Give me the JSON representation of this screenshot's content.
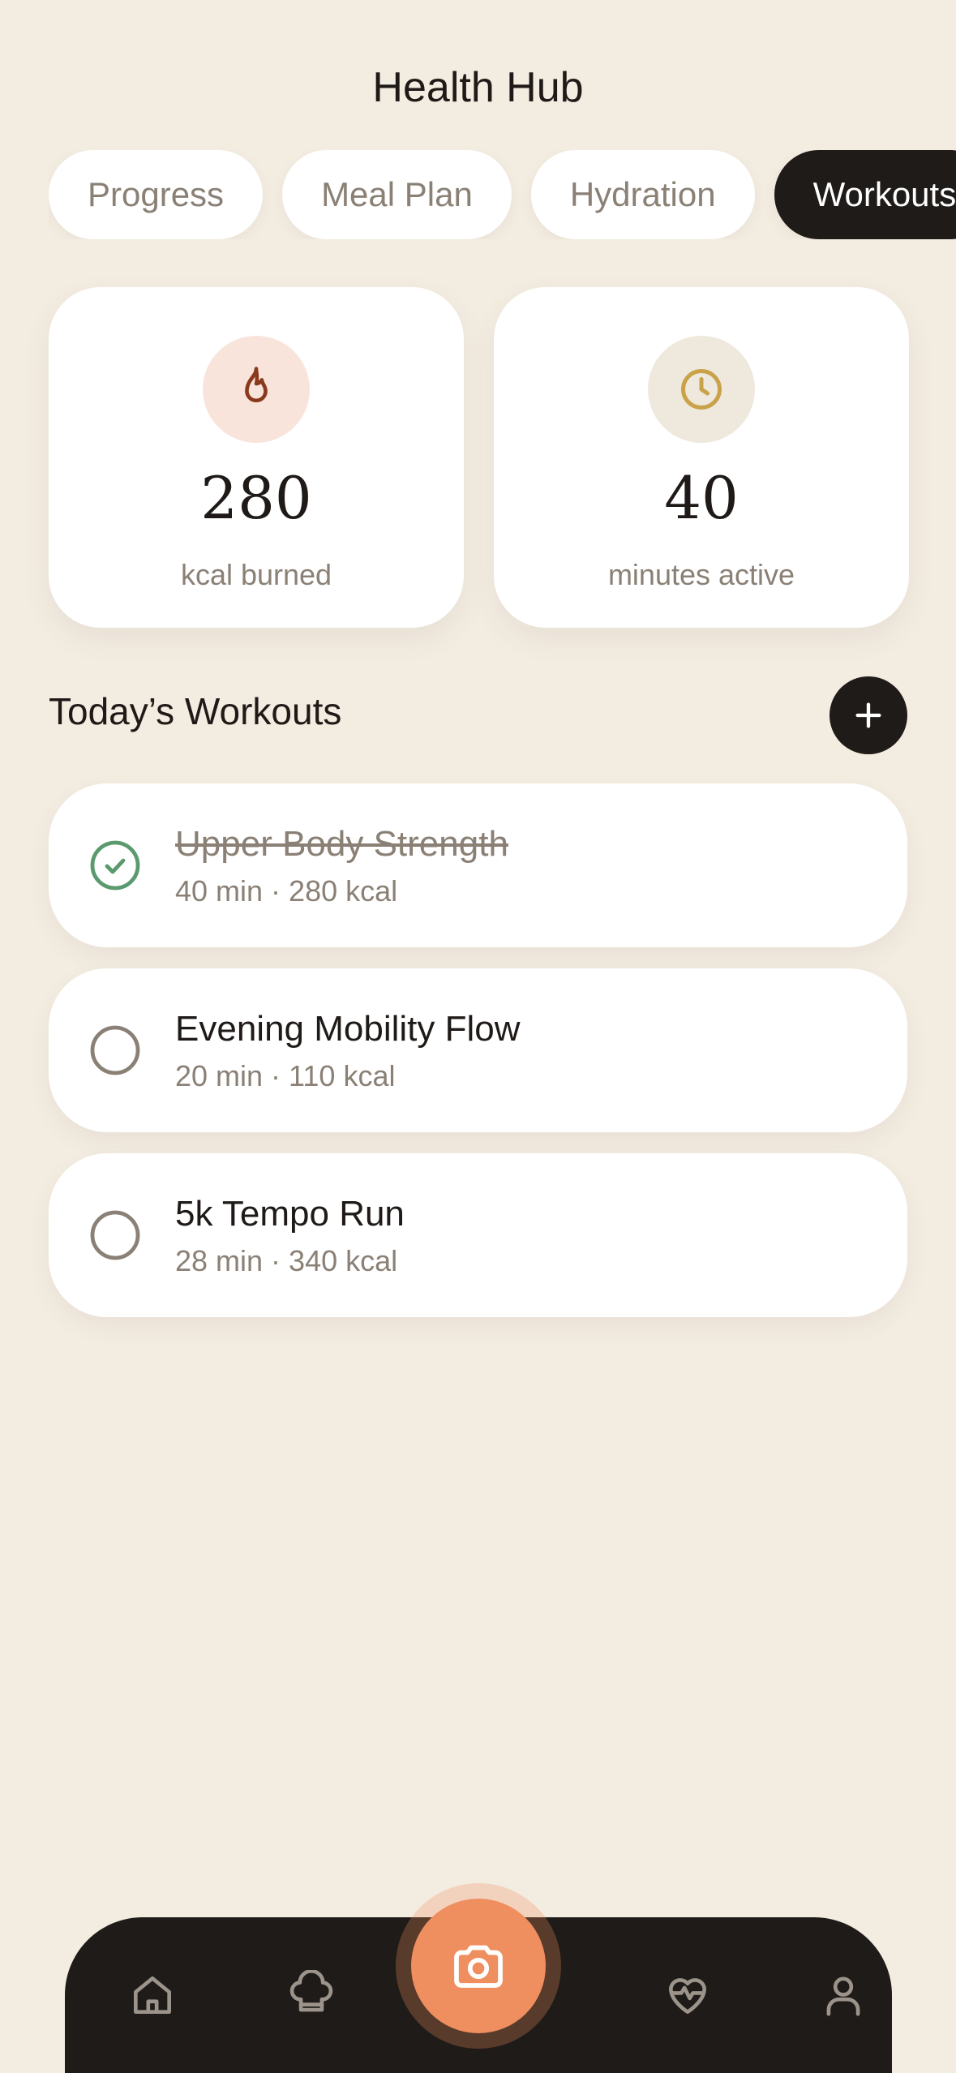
{
  "header": {
    "title": "Health Hub"
  },
  "tabs": [
    {
      "label": "Progress",
      "active": false
    },
    {
      "label": "Meal Plan",
      "active": false
    },
    {
      "label": "Hydration",
      "active": false
    },
    {
      "label": "Workouts",
      "active": true
    }
  ],
  "stats": [
    {
      "icon": "flame-icon",
      "value": "280",
      "label": "kcal burned",
      "accent": "#8a3a1c",
      "bg": "#f8e4da"
    },
    {
      "icon": "clock-icon",
      "value": "40",
      "label": "minutes active",
      "accent": "#c9a24a",
      "bg": "#efe9dd"
    }
  ],
  "section": {
    "title": "Today’s Workouts",
    "add_icon": "plus-icon"
  },
  "workouts": [
    {
      "name": "Upper Body Strength",
      "meta": "40 min · 280 kcal",
      "completed": true
    },
    {
      "name": "Evening Mobility Flow",
      "meta": "20 min · 110 kcal",
      "completed": false
    },
    {
      "name": "5k Tempo Run",
      "meta": "28 min · 340 kcal",
      "completed": false
    }
  ],
  "bottom_nav": {
    "items": [
      "home-icon",
      "chef-hat-icon",
      "camera-icon",
      "heart-pulse-icon",
      "user-icon"
    ],
    "active": "camera-icon"
  },
  "colors": {
    "background": "#f3ece1",
    "dark": "#1f1b18",
    "accent": "#ef8e5f",
    "success": "#5a9a6e",
    "muted": "#8a8075"
  }
}
